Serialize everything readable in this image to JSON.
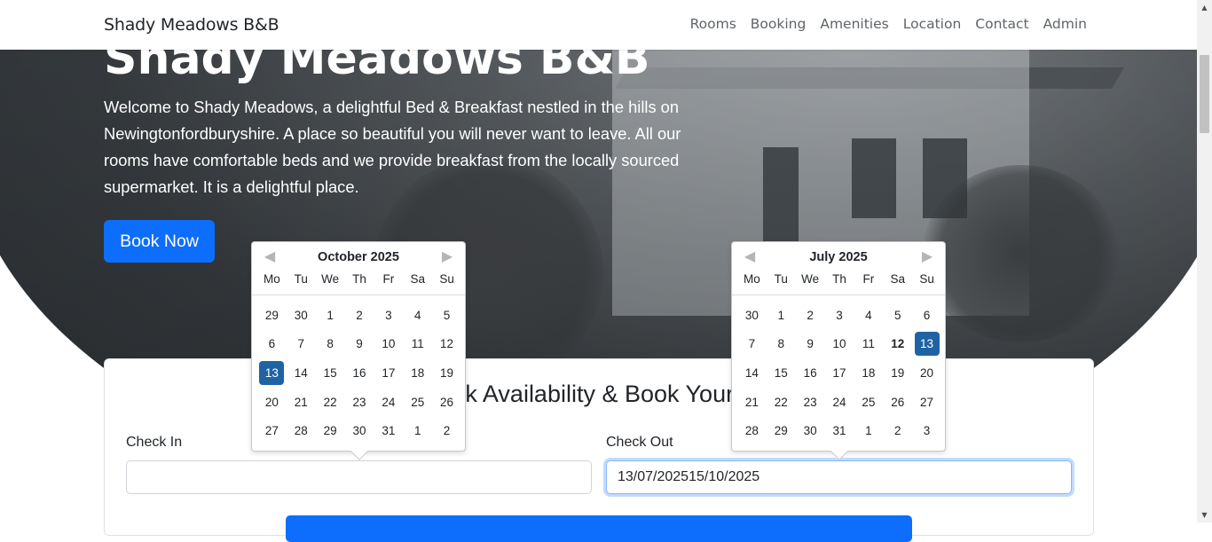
{
  "navbar": {
    "brand": "Shady Meadows B&B",
    "links": [
      "Rooms",
      "Booking",
      "Amenities",
      "Location",
      "Contact",
      "Admin"
    ]
  },
  "hero": {
    "title": "Shady Meadows B&B",
    "description": "Welcome to Shady Meadows, a delightful Bed & Breakfast nestled in the hills on Newingtonfordburyshire. A place so beautiful you will never want to leave. All our rooms have comfortable beds and we provide breakfast from the locally sourced supermarket. It is a delightful place.",
    "book_now_label": "Book Now"
  },
  "booking": {
    "title": "Check Availability & Book Your Stay",
    "check_in_label": "Check In",
    "check_in_value": "",
    "check_out_label": "Check Out",
    "check_out_value": "13/07/202515/10/2025"
  },
  "datepickers": {
    "weekdays": [
      "Mo",
      "Tu",
      "We",
      "Th",
      "Fr",
      "Sa",
      "Su"
    ],
    "left": {
      "month": "October 2025",
      "days": [
        "29",
        "30",
        "1",
        "2",
        "3",
        "4",
        "5",
        "6",
        "7",
        "8",
        "9",
        "10",
        "11",
        "12",
        "13",
        "14",
        "15",
        "16",
        "17",
        "18",
        "19",
        "20",
        "21",
        "22",
        "23",
        "24",
        "25",
        "26",
        "27",
        "28",
        "29",
        "30",
        "31",
        "1",
        "2"
      ],
      "selected_index": 14,
      "today_index": -1
    },
    "right": {
      "month": "July 2025",
      "days": [
        "30",
        "1",
        "2",
        "3",
        "4",
        "5",
        "6",
        "7",
        "8",
        "9",
        "10",
        "11",
        "12",
        "13",
        "14",
        "15",
        "16",
        "17",
        "18",
        "19",
        "20",
        "21",
        "22",
        "23",
        "24",
        "25",
        "26",
        "27",
        "28",
        "29",
        "30",
        "31",
        "1",
        "2",
        "3"
      ],
      "selected_index": 13,
      "today_index": 12
    }
  },
  "colors": {
    "primary": "#0d6efd",
    "selected_day": "#2063a5"
  }
}
